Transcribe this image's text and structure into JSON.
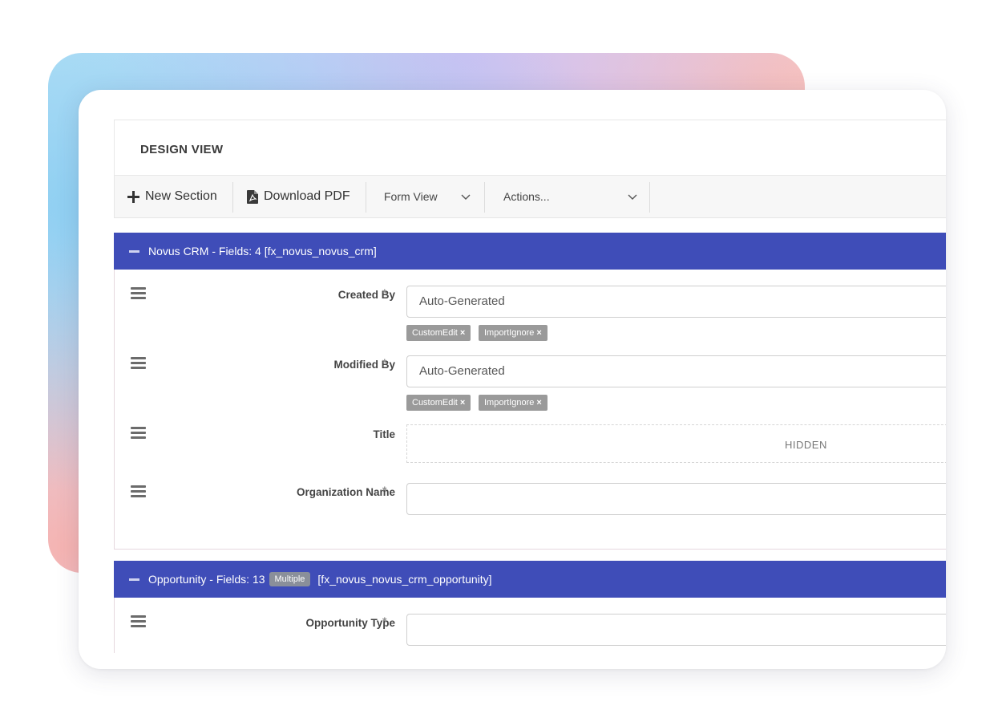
{
  "page": {
    "title": "DESIGN VIEW"
  },
  "toolbar": {
    "new_section": "New Section",
    "download_pdf": "Download PDF",
    "form_view": "Form View",
    "actions": "Actions..."
  },
  "sections": [
    {
      "header": "Novus CRM - Fields: 4 [fx_novus_novus_crm]",
      "fields": [
        {
          "label": "Created By",
          "required": "*",
          "value": "Auto-Generated",
          "tags": [
            "CustomEdit",
            "ImportIgnore"
          ]
        },
        {
          "label": "Modified By",
          "required": "*",
          "value": "Auto-Generated",
          "tags": [
            "CustomEdit",
            "ImportIgnore"
          ]
        },
        {
          "label": "Title",
          "hidden_text": "HIDDEN"
        },
        {
          "label": "Organization Name",
          "required": "*",
          "value": ""
        }
      ]
    },
    {
      "header_prefix": "Opportunity - Fields: 13",
      "badge": "Multiple",
      "header_suffix": "[fx_novus_novus_crm_opportunity]",
      "fields": [
        {
          "label": "Opportunity Type",
          "required": "*",
          "value": ""
        }
      ]
    }
  ],
  "tag_remove_glyph": "×",
  "colors": {
    "section_header": "#3f4db8",
    "tag": "#9a9a9a",
    "badge": "#8a8f9a"
  }
}
